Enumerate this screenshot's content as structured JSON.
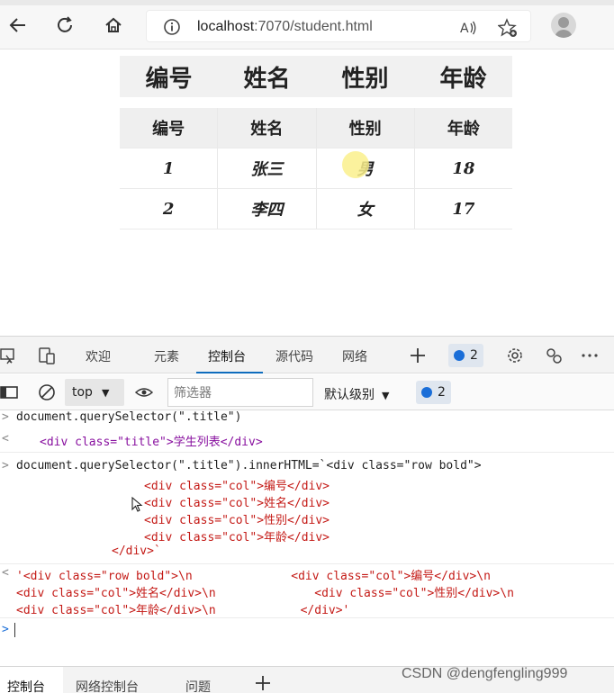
{
  "browser": {
    "url_host": "localhost",
    "url_path": ":7070/student.html"
  },
  "page": {
    "title_row": [
      "编号",
      "姓名",
      "性别",
      "年龄"
    ],
    "table": {
      "headers": [
        "编号",
        "姓名",
        "性别",
        "年龄"
      ],
      "rows": [
        [
          "1",
          "张三",
          "男",
          "18"
        ],
        [
          "2",
          "李四",
          "女",
          "17"
        ]
      ]
    }
  },
  "devtools": {
    "tabs": [
      "欢迎",
      "元素",
      "控制台",
      "源代码",
      "网络"
    ],
    "issues_count": "2",
    "toolbar": {
      "context": "top",
      "filter_placeholder": "筛选器",
      "level": "默认级别",
      "message_count": "2"
    },
    "console": {
      "lines": [
        "document.querySelector(\".title\")",
        "<div class=\"title\">学生列表</div>",
        "document.querySelector(\".title\").innerHTML=`<div class=\"row bold\">",
        "<div class=\"col\">编号</div>",
        "<div class=\"col\">姓名</div>",
        "<div class=\"col\">性别</div>",
        "<div class=\"col\">年龄</div>",
        "</div>`",
        "'<div class=\"row bold\">\\n              <div class=\"col\">编号</div>\\n",
        "<div class=\"col\">姓名</div>\\n              <div class=\"col\">性别</div>\\n",
        "<div class=\"col\">年龄</div>\\n            </div>'"
      ]
    },
    "drawer_tabs": [
      "控制台",
      "网络控制台",
      "问题"
    ]
  },
  "watermark": "CSDN @dengfengling999",
  "colors": {
    "accent": "#0f6cbd",
    "badge_dot": "#1a6ed8",
    "string_red": "#c41a16"
  }
}
